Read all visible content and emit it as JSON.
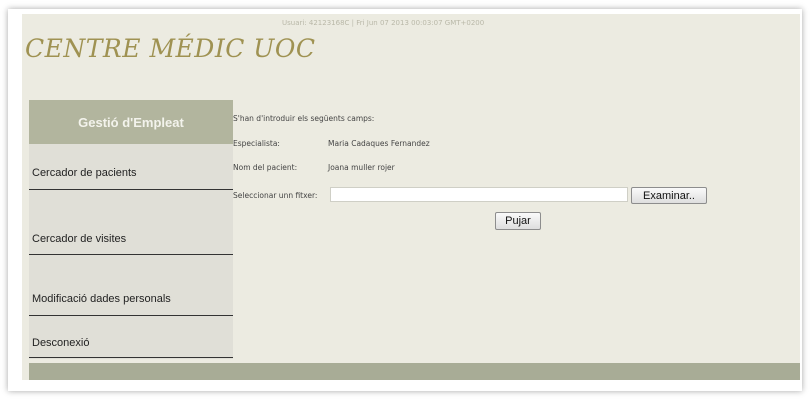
{
  "header": {
    "user_info": "Usuari: 42123168C | Fri Jun 07 2013 00:03:07 GMT+0200",
    "logo": "CENTRE MÉDIC UOC"
  },
  "sidebar": {
    "title": "Gestió d'Empleat",
    "items": [
      {
        "label": "Cercador de pacients"
      },
      {
        "label": "Cercador de visites"
      },
      {
        "label": "Modificació dades personals"
      },
      {
        "label": "Desconexió"
      }
    ]
  },
  "main": {
    "intro": "S'han d'introduir els següents camps:",
    "specialist_label": "Especialista:",
    "specialist_value": "Maria Cadaques Fernandez",
    "patient_label": "Nom del pacient:",
    "patient_value": "Joana muller rojer",
    "file_label": "Seleccionar unn fitxer:",
    "file_value": "",
    "browse_label": "Examinar..",
    "upload_label": "Pujar"
  },
  "colors": {
    "page_bg": "#ecebe1",
    "sidebar_title_bg": "#b2b59e",
    "sidebar_bg": "#e0dfd7",
    "logo": "#9f9252",
    "footer": "#a8ac96"
  }
}
